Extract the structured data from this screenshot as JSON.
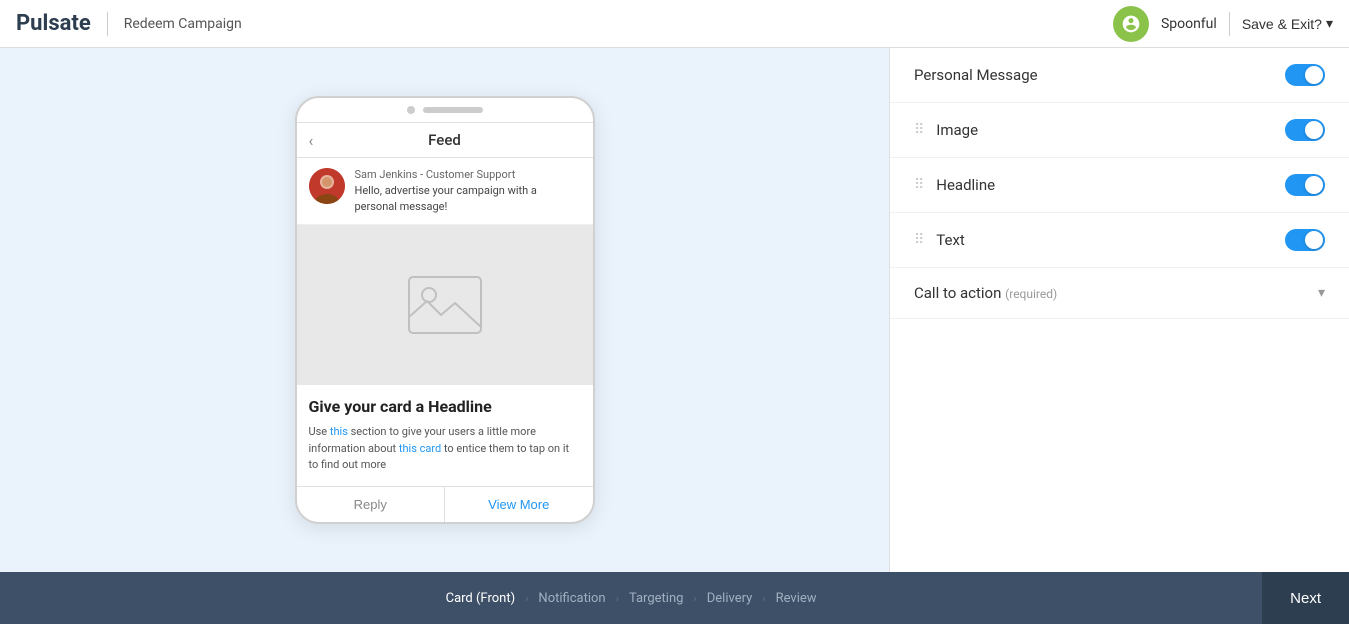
{
  "header": {
    "logo": "Pulsate",
    "campaign": "Redeem Campaign",
    "user": "Spoonful",
    "save_exit": "Save & Exit?"
  },
  "phone": {
    "feed_title": "Feed",
    "message": {
      "sender_name": "Sam Jenkins",
      "sender_role": "Customer Support",
      "text": "Hello, advertise your campaign with a personal message!"
    },
    "card": {
      "headline": "Give your card a Headline",
      "description_parts": [
        "Use ",
        "this",
        " section to give your users a little more information about ",
        "this card",
        " to entice them to tap on it to find out more"
      ],
      "reply_label": "Reply",
      "view_more_label": "View More"
    }
  },
  "settings": {
    "personal_message": {
      "label": "Personal Message",
      "enabled": true
    },
    "image": {
      "label": "Image",
      "enabled": true
    },
    "headline": {
      "label": "Headline",
      "enabled": true
    },
    "text": {
      "label": "Text",
      "enabled": true
    },
    "call_to_action": {
      "label": "Call to action",
      "required_label": "(required)"
    }
  },
  "footer": {
    "steps": [
      {
        "label": "Card (Front)",
        "active": true
      },
      {
        "label": "Notification",
        "active": false
      },
      {
        "label": "Targeting",
        "active": false
      },
      {
        "label": "Delivery",
        "active": false
      },
      {
        "label": "Review",
        "active": false
      }
    ],
    "next_label": "Next"
  }
}
